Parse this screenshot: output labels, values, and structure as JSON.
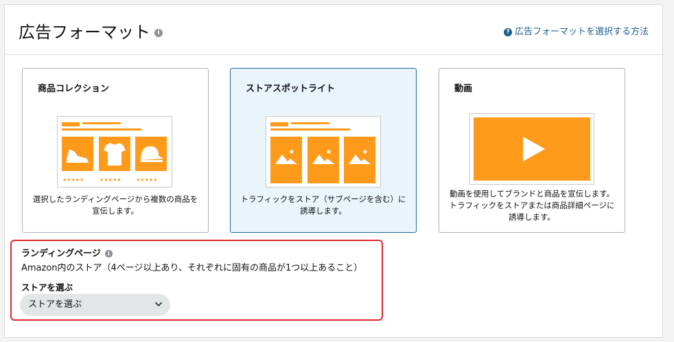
{
  "header": {
    "title": "広告フォーマット",
    "help_link": "広告フォーマットを選択する方法"
  },
  "formats": [
    {
      "title": "商品コレクション",
      "description": "選択したランディングページから複数の商品を宣伝します。",
      "selected": false
    },
    {
      "title": "ストアスポットライト",
      "description": "トラフィックをストア（サブページを含む）に誘導します。",
      "selected": true
    },
    {
      "title": "動画",
      "description": "動画を使用してブランドと商品を宣伝します。トラフィックをストアまたは商品詳細ページに誘導します。",
      "selected": false
    }
  ],
  "landing_page": {
    "label": "ランディングページ",
    "description": "Amazon内のストア（4ページ以上あり、それぞれに固有の商品が1つ以上あること）",
    "store_label": "ストアを選ぶ",
    "store_select_value": "ストアを選ぶ"
  },
  "colors": {
    "accent_orange": "#ff9a1a",
    "link_blue": "#1a5d8f",
    "selected_bg": "#eaf4fb",
    "highlight_red": "#e0242b"
  }
}
